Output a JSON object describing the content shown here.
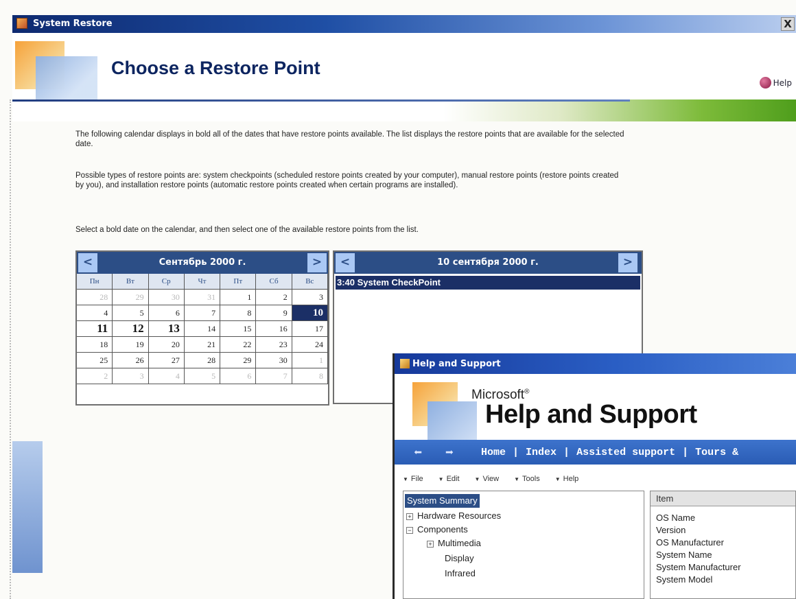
{
  "system_restore": {
    "window_title": "System Restore",
    "close_glyph": "X",
    "heading": "Choose a Restore Point",
    "help_label": "Help",
    "paragraphs": [
      "The following calendar displays in bold all of the dates that have restore points available. The list displays the restore points that are available for the selected date.",
      "Possible types of restore points are: system checkpoints (scheduled restore points created by your computer), manual restore points (restore points created by you), and installation restore points (automatic restore points created when certain programs are installed).",
      "Select a bold date on the calendar, and then select one of the available restore points from the list."
    ],
    "calendar": {
      "title": "Сентябрь 2000 г.",
      "prev": "<",
      "next": ">",
      "weekdays": [
        "Пн",
        "Вт",
        "Ср",
        "Чт",
        "Пт",
        "Сб",
        "Вс"
      ],
      "weeks": [
        [
          "28",
          "29",
          "30",
          "31",
          "1",
          "2",
          "3"
        ],
        [
          "4",
          "5",
          "6",
          "7",
          "8",
          "9",
          "10"
        ],
        [
          "11",
          "12",
          "13",
          "14",
          "15",
          "16",
          "17"
        ],
        [
          "18",
          "19",
          "20",
          "21",
          "22",
          "23",
          "24"
        ],
        [
          "25",
          "26",
          "27",
          "28",
          "29",
          "30",
          "1"
        ],
        [
          "2",
          "3",
          "4",
          "5",
          "6",
          "7",
          "8"
        ]
      ],
      "selected_day": "10"
    },
    "restore_list": {
      "title": "10 сентября 2000 г.",
      "prev": "<",
      "next": ">",
      "items": [
        "3:40 System CheckPoint"
      ]
    }
  },
  "help_support": {
    "window_title": "Help and Support",
    "brand": "Microsoft",
    "brand_mark": "®",
    "product": "Help and Support",
    "nav": {
      "back": "⬅",
      "forward": "➡",
      "links": [
        "Home",
        "Index",
        "Assisted support",
        "Tours &"
      ],
      "separator": "|"
    },
    "menu": [
      "File",
      "Edit",
      "View",
      "Tools",
      "Help"
    ],
    "tree": [
      {
        "label": "System Summary",
        "level": 0,
        "toggle": ""
      },
      {
        "label": "Hardware Resources",
        "level": 0,
        "toggle": "+"
      },
      {
        "label": "Components",
        "level": 0,
        "toggle": "−"
      },
      {
        "label": "Multimedia",
        "level": 1,
        "toggle": "+"
      },
      {
        "label": "Display",
        "level": 2,
        "toggle": ""
      },
      {
        "label": "Infrared",
        "level": 2,
        "toggle": ""
      }
    ],
    "items_header": "Item",
    "items": [
      "OS Name",
      "Version",
      "OS Manufacturer",
      "System Name",
      "System Manufacturer",
      "System Model"
    ]
  }
}
